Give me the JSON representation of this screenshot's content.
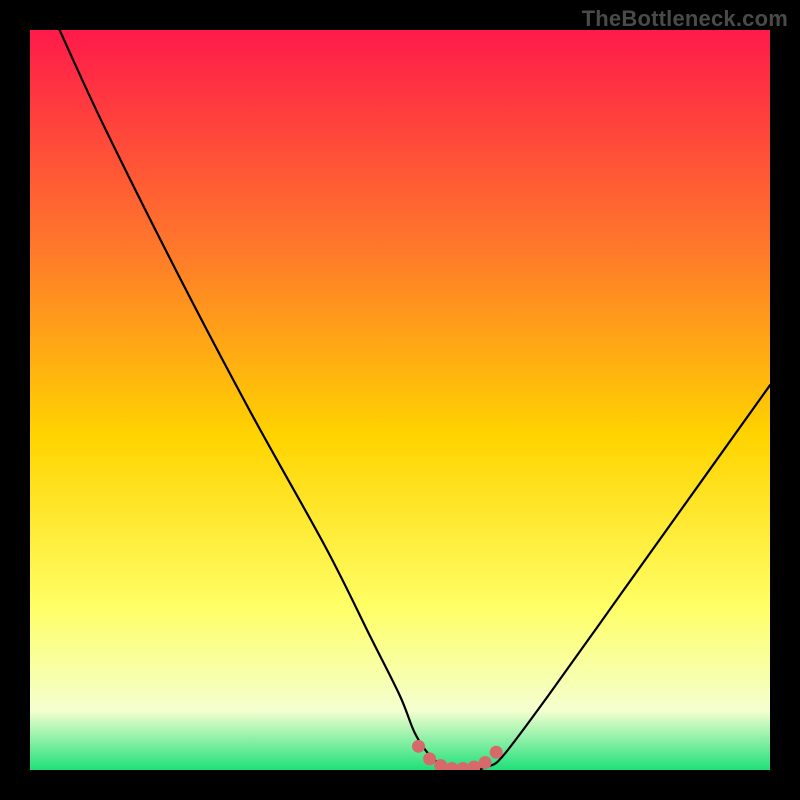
{
  "watermark": "TheBottleneck.com",
  "colors": {
    "gradient_top": "#ff1a4a",
    "gradient_mid1": "#ff7a2a",
    "gradient_mid2": "#ffd400",
    "gradient_mid3": "#ffff66",
    "gradient_mid4": "#f4ffd0",
    "gradient_bottom": "#1fe07a",
    "curve": "#000000",
    "marker_fill": "#d66a6a",
    "marker_stroke": "#a04444"
  },
  "chart_data": {
    "type": "line",
    "title": "",
    "xlabel": "",
    "ylabel": "",
    "xlim": [
      0,
      100
    ],
    "ylim": [
      0,
      100
    ],
    "series": [
      {
        "name": "bottleneck-curve",
        "x": [
          4,
          10,
          20,
          30,
          40,
          46,
          50,
          52,
          54,
          56,
          58,
          60,
          62,
          64,
          70,
          80,
          90,
          100
        ],
        "y": [
          100,
          87,
          67,
          48,
          30,
          18,
          10,
          5,
          2,
          0.5,
          0,
          0,
          0.5,
          2,
          10,
          24,
          38,
          52
        ]
      }
    ],
    "markers": {
      "name": "optimal-zone",
      "x": [
        52.5,
        54,
        55.5,
        57,
        58.5,
        60,
        61.5,
        63
      ],
      "y": [
        3.2,
        1.5,
        0.6,
        0.2,
        0.2,
        0.4,
        1.0,
        2.4
      ]
    }
  }
}
